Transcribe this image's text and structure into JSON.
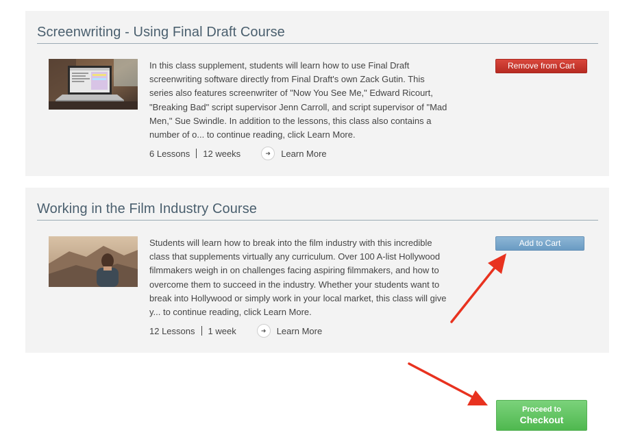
{
  "courses": [
    {
      "title": "Screenwriting - Using Final Draft Course",
      "description": "In this class supplement, students will learn how to use Final Draft screenwriting software directly from Final Draft's own Zack Gutin. This series also features screenwriter of \"Now You See Me,\" Edward Ricourt, \"Breaking Bad\" script supervisor Jenn Carroll, and script supervisor of \"Mad Men,\" Sue Swindle. In addition to the lessons, this class also contains a number of o... to continue reading, click Learn More.",
      "lessons": "6 Lessons",
      "duration": "12 weeks",
      "learn_more": "Learn More",
      "cart_button": "Remove from Cart"
    },
    {
      "title": "Working in the Film Industry Course",
      "description": "Students will learn how to break into the film industry with this incredible class that supplements virtually any curriculum. Over 100 A-list Hollywood filmmakers weigh in on challenges facing aspiring filmmakers, and how to overcome them to succeed in the industry. Whether your students want to break into Hollywood or simply work in your local market, this class will give y... to continue reading, click Learn More.",
      "lessons": "12 Lessons",
      "duration": "1 week",
      "learn_more": "Learn More",
      "cart_button": "Add to Cart"
    }
  ],
  "checkout": {
    "line1": "Proceed to",
    "line2": "Checkout"
  },
  "icons": {
    "learn_more": "arrow-right-circle-icon",
    "annotation": "red-arrow-annotation"
  },
  "colors": {
    "remove": "#c5342a",
    "add": "#7aa9cd",
    "checkout": "#5cc05c",
    "annotation": "#e8321f",
    "title": "#4a5f6e"
  }
}
